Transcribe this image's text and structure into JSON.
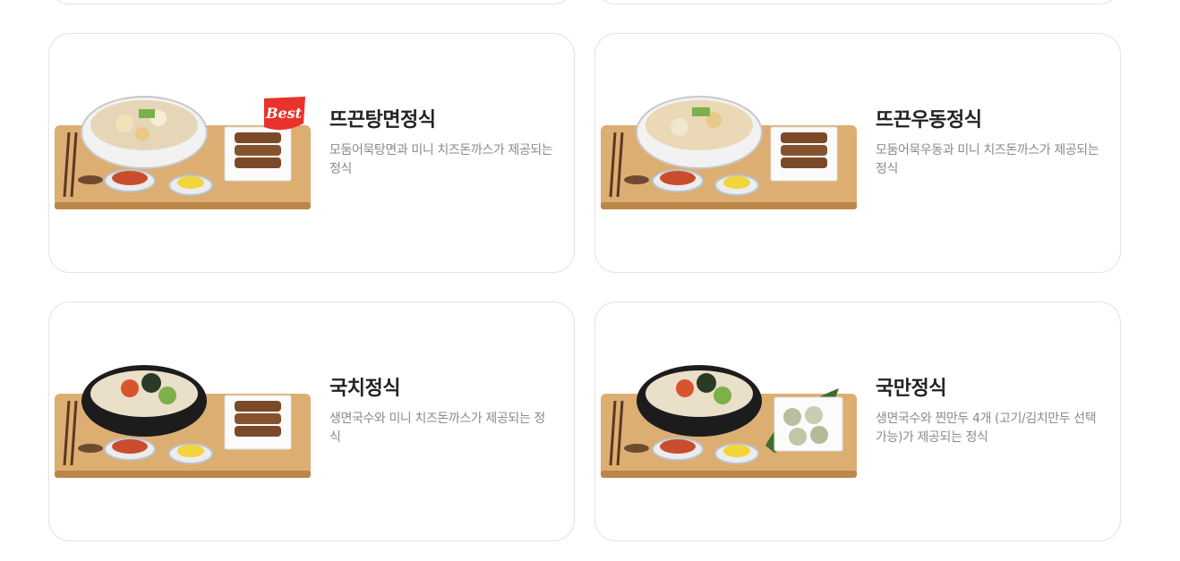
{
  "menu": [
    {
      "title": "뜨끈탕면정식",
      "description": "모둠어묵탕면과 미니 치즈돈까스가 제공되는 정식",
      "badge": "Best",
      "bowl": "white",
      "side": "cutlet"
    },
    {
      "title": "뜨끈우동정식",
      "description": "모둠어묵우동과 미니 치즈돈까스가 제공되는 정식",
      "bowl": "white",
      "side": "cutlet"
    },
    {
      "title": "국치정식",
      "description": "생면국수와 미니 치즈돈까스가 제공되는 정식",
      "bowl": "black",
      "side": "cutlet"
    },
    {
      "title": "국만정식",
      "description": "생면국수와 찐만두 4개 (고기/김치만두 선택가능)가 제공되는 정식",
      "bowl": "black",
      "side": "dumplings"
    }
  ],
  "colors": {
    "badge": "#e8322b",
    "card_border": "#e3e3e3",
    "title": "#222222",
    "description": "#8a8a8a"
  }
}
